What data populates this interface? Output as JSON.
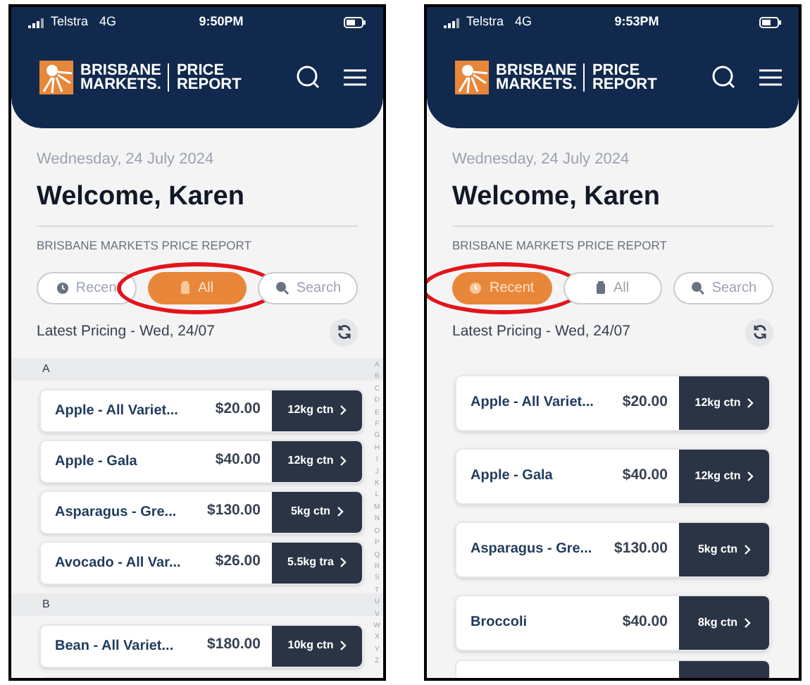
{
  "screens": [
    {
      "status": {
        "carrier": "Telstra",
        "network": "4G",
        "time": "9:50PM"
      },
      "logo": {
        "brand_line1": "BRISBANE",
        "brand_line2": "MARKETS.",
        "product_line1": "PRICE",
        "product_line2": "REPORT"
      },
      "date": "Wednesday, 24 July 2024",
      "welcome": "Welcome, Karen",
      "section_label": "BRISBANE MARKETS PRICE REPORT",
      "tabs": [
        {
          "label": "Recen",
          "kind": "recent",
          "selected": false,
          "circled": false
        },
        {
          "label": "All",
          "kind": "all",
          "selected": true,
          "circled": true
        },
        {
          "label": "Search",
          "kind": "search",
          "selected": false,
          "circled": false
        }
      ],
      "pricing_label": "Latest Pricing - Wed, 24/07",
      "groups": [
        {
          "letter": "A",
          "rows": [
            {
              "name": "Apple - All Variet...",
              "price": "$20.00",
              "unit": "12kg ctn"
            },
            {
              "name": "Apple - Gala",
              "price": "$40.00",
              "unit": "12kg ctn"
            },
            {
              "name": "Asparagus - Gre...",
              "price": "$130.00",
              "unit": "5kg ctn"
            },
            {
              "name": "Avocado - All Var...",
              "price": "$26.00",
              "unit": "5.5kg tra"
            }
          ]
        },
        {
          "letter": "B",
          "rows": [
            {
              "name": "Bean - All Variet...",
              "price": "$180.00",
              "unit": "10kg ctn"
            }
          ]
        }
      ],
      "index_letters": [
        "A",
        "B",
        "C",
        "D",
        "E",
        "F",
        "G",
        "H",
        "I",
        "J",
        "K",
        "L",
        "M",
        "N",
        "O",
        "P",
        "Q",
        "R",
        "S",
        "T",
        "U",
        "V",
        "W",
        "X",
        "Y",
        "Z"
      ]
    },
    {
      "status": {
        "carrier": "Telstra",
        "network": "4G",
        "time": "9:53PM"
      },
      "logo": {
        "brand_line1": "BRISBANE",
        "brand_line2": "MARKETS.",
        "product_line1": "PRICE",
        "product_line2": "REPORT"
      },
      "date": "Wednesday, 24 July 2024",
      "welcome": "Welcome, Karen",
      "section_label": "BRISBANE MARKETS PRICE REPORT",
      "tabs": [
        {
          "label": "Recent",
          "kind": "recent",
          "selected": true,
          "circled": true
        },
        {
          "label": "All",
          "kind": "all",
          "selected": false,
          "circled": false
        },
        {
          "label": "Search",
          "kind": "search",
          "selected": false,
          "circled": false
        }
      ],
      "pricing_label": "Latest Pricing - Wed, 24/07",
      "groups": [
        {
          "rows": [
            {
              "name": "Apple - All Variet...",
              "price": "$20.00",
              "unit": "12kg ctn"
            },
            {
              "name": "Apple - Gala",
              "price": "$40.00",
              "unit": "12kg ctn"
            },
            {
              "name": "Asparagus - Gre...",
              "price": "$130.00",
              "unit": "5kg ctn"
            },
            {
              "name": "Broccoli",
              "price": "$40.00",
              "unit": "8kg ctn"
            }
          ]
        }
      ]
    }
  ]
}
